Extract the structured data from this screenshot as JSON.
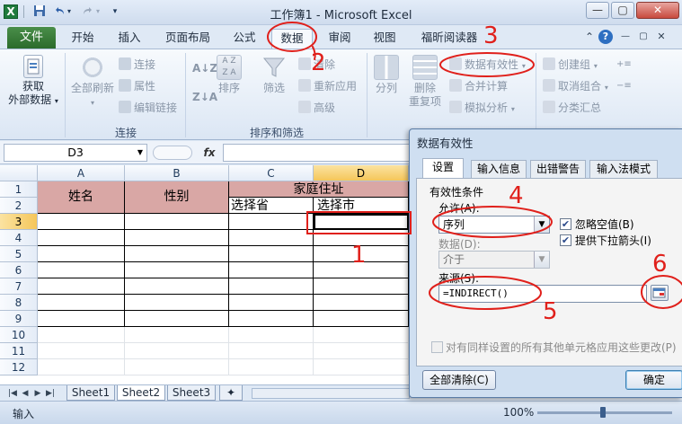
{
  "window": {
    "title": "工作簿1 - Microsoft Excel",
    "app_icon": "X",
    "controls": {
      "minimize": "▭",
      "restore": "▢",
      "close": "✕"
    }
  },
  "tabs": {
    "file": "文件",
    "items": [
      "开始",
      "插入",
      "页面布局",
      "公式",
      "数据",
      "审阅",
      "视图",
      "福昕阅读器"
    ],
    "active": "数据"
  },
  "ribbon": {
    "get_external": "获取\n外部数据",
    "get_external_l1": "获取",
    "get_external_l2": "外部数据",
    "refresh_all": "全部刷新",
    "connections": "连接",
    "properties": "属性",
    "edit_links": "编辑链接",
    "group_connections": "连接",
    "sort": "排序",
    "filter": "筛选",
    "clear": "清除",
    "reapply": "重新应用",
    "advanced": "高级",
    "group_sort_filter": "排序和筛选",
    "text_to_columns": "分列",
    "remove_duplicates_l1": "删除",
    "remove_duplicates_l2": "重复项",
    "data_validation": "数据有效性",
    "consolidate": "合并计算",
    "what_if": "模拟分析",
    "group": "创建组",
    "ungroup": "取消组合",
    "subtotal": "分类汇总"
  },
  "formula_bar": {
    "name_box": "D3",
    "fx": "fx",
    "value": ""
  },
  "sheet": {
    "columns": [
      "A",
      "B",
      "C",
      "D"
    ],
    "selected_column": "D",
    "rows": [
      "1",
      "2",
      "3",
      "4",
      "5",
      "6",
      "7",
      "8",
      "9",
      "10",
      "11",
      "12"
    ],
    "selected_row": "3",
    "header_name": "姓名",
    "header_gender": "性别",
    "header_address": "家庭住址",
    "header_province": "选择省",
    "header_city": "选择市"
  },
  "sheet_tabs": [
    "Sheet1",
    "Sheet2",
    "Sheet3"
  ],
  "active_sheet": "Sheet2",
  "status": {
    "mode": "输入",
    "zoom": "100%"
  },
  "dialog": {
    "title": "数据有效性",
    "tabs": [
      "设置",
      "输入信息",
      "出错警告",
      "输入法模式"
    ],
    "active_tab": "设置",
    "criteria_label": "有效性条件",
    "allow_label": "允许(A):",
    "allow_value": "序列",
    "ignore_blank": "忽略空值(B)",
    "in_cell_dropdown": "提供下拉箭头(I)",
    "data_label": "数据(D):",
    "data_value": "介于",
    "source_label": "来源(S):",
    "source_value": "=INDIRECT()",
    "apply_all": "对有同样设置的所有其他单元格应用这些更改(P)",
    "clear_all": "全部清除(C)",
    "ok": "确定"
  },
  "annotations": [
    "1",
    "2",
    "3",
    "4",
    "5",
    "6"
  ],
  "colors": {
    "accent_red": "#e0201b",
    "header_pink": "#d9a7a5",
    "file_green": "#2b6b2b"
  }
}
